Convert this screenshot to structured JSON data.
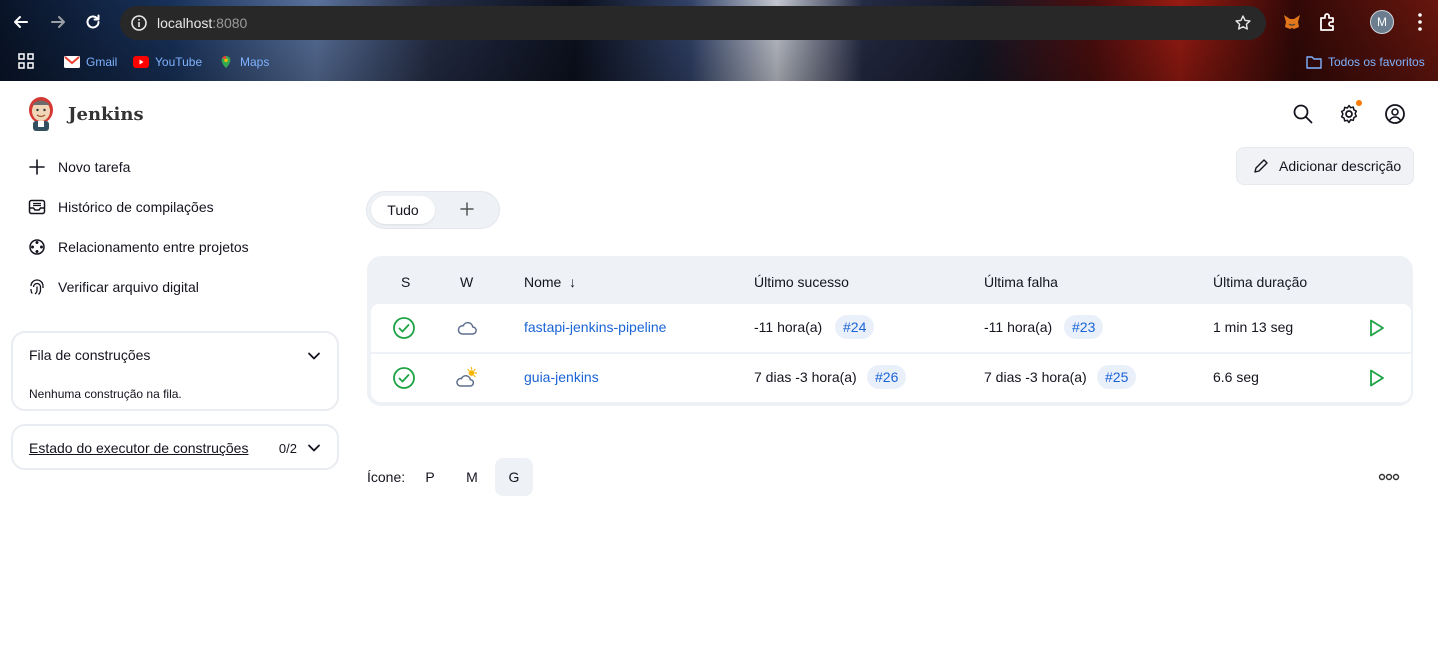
{
  "browser": {
    "url_host": "localhost",
    "url_port": ":8080",
    "profile_initial": "M",
    "bookmarks": [
      {
        "label": "Gmail"
      },
      {
        "label": "YouTube"
      },
      {
        "label": "Maps"
      }
    ],
    "all_bookmarks_label": "Todos os favoritos"
  },
  "header": {
    "brand": "Jenkins"
  },
  "sidebar": {
    "items": [
      {
        "label": "Novo tarefa"
      },
      {
        "label": "Histórico de compilações"
      },
      {
        "label": "Relacionamento entre projetos"
      },
      {
        "label": "Verificar arquivo digital"
      }
    ],
    "queue": {
      "title": "Fila de construções",
      "empty": "Nenhuma construção na fila."
    },
    "executors": {
      "title": "Estado do executor de construções",
      "count": "0/2"
    }
  },
  "main": {
    "add_description": "Adicionar descrição",
    "tabs": [
      {
        "label": "Tudo"
      }
    ],
    "table": {
      "headers": {
        "s": "S",
        "w": "W",
        "name": "Nome",
        "sort_arrow": "↓",
        "last_success": "Último sucesso",
        "last_failure": "Última falha",
        "last_duration": "Última duração"
      },
      "rows": [
        {
          "status": "success",
          "weather": "cloudy",
          "name": "fastapi-jenkins-pipeline",
          "last_success": "-11 hora(a)",
          "last_success_build": "#24",
          "last_failure": "-11 hora(a)",
          "last_failure_build": "#23",
          "duration": "1 min 13 seg"
        },
        {
          "status": "success",
          "weather": "partly-sunny",
          "name": "guia-jenkins",
          "last_success": "7 dias -3 hora(a)",
          "last_success_build": "#26",
          "last_failure": "7 dias -3 hora(a)",
          "last_failure_build": "#25",
          "duration": "6.6 seg"
        }
      ]
    },
    "icon_size": {
      "label": "Ícone:",
      "options": [
        "P",
        "M",
        "G"
      ],
      "selected": "G"
    }
  },
  "colors": {
    "link": "#1a64d6",
    "success": "#1ea446",
    "notification": "#ff7a00"
  }
}
